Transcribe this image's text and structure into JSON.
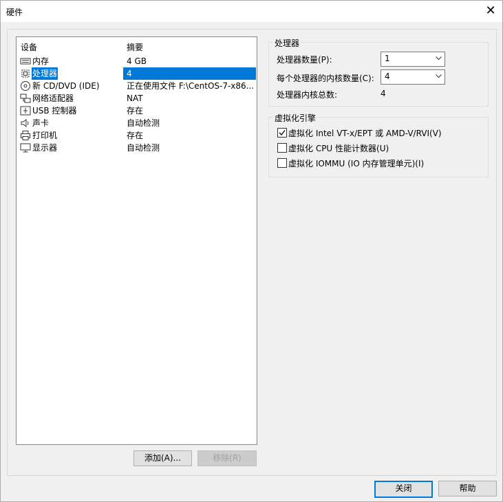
{
  "window": {
    "title": "硬件"
  },
  "devices": {
    "header": {
      "device": "设备",
      "summary": "摘要"
    },
    "items": [
      {
        "name": "内存",
        "summary": "4 GB",
        "icon": "memory-icon"
      },
      {
        "name": "处理器",
        "summary": "4",
        "icon": "processor-icon",
        "selected": true
      },
      {
        "name": "新 CD/DVD (IDE)",
        "summary": "正在使用文件 F:\\CentOS-7-x86...",
        "icon": "cd-dvd-icon"
      },
      {
        "name": "网络适配器",
        "summary": "NAT",
        "icon": "network-adapter-icon"
      },
      {
        "name": "USB 控制器",
        "summary": "存在",
        "icon": "usb-icon"
      },
      {
        "name": "声卡",
        "summary": "自动检测",
        "icon": "speaker-icon"
      },
      {
        "name": "打印机",
        "summary": "存在",
        "icon": "printer-icon"
      },
      {
        "name": "显示器",
        "summary": "自动检测",
        "icon": "display-icon"
      }
    ],
    "add_button": "添加(A)...",
    "remove_button": "移除(R)"
  },
  "processor": {
    "group_title": "处理器",
    "count_label": "处理器数量(P):",
    "count_value": "1",
    "cores_label": "每个处理器的内核数量(C):",
    "cores_value": "4",
    "total_label": "处理器内核总数:",
    "total_value": "4"
  },
  "virtualization": {
    "group_title": "虚拟化引擎",
    "options": [
      {
        "label": "虚拟化 Intel VT-x/EPT 或 AMD-V/RVI(V)",
        "checked": true
      },
      {
        "label": "虚拟化 CPU 性能计数器(U)",
        "checked": false
      },
      {
        "label": "虚拟化 IOMMU (IO 内存管理单元)(I)",
        "checked": false
      }
    ]
  },
  "footer": {
    "close_button": "关闭",
    "help_button": "帮助"
  }
}
